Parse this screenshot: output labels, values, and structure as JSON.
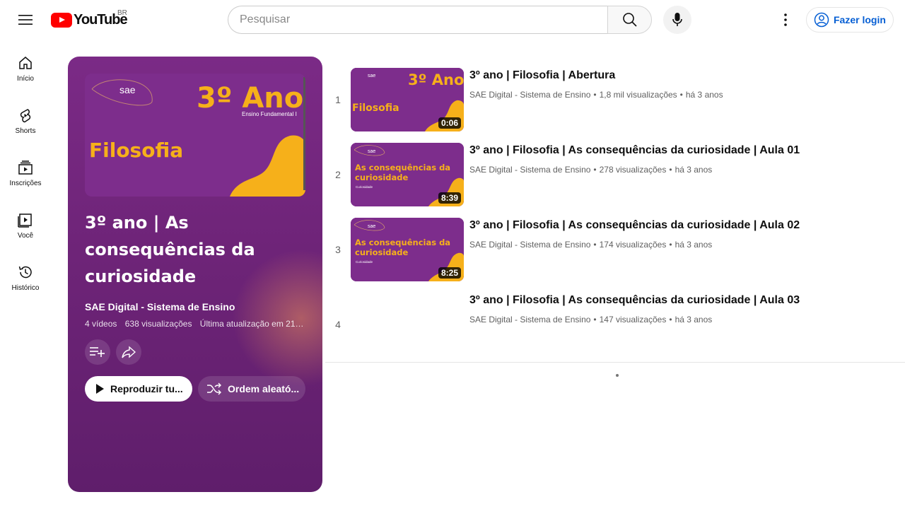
{
  "header": {
    "logo_text": "YouTube",
    "country_code": "BR",
    "search_placeholder": "Pesquisar",
    "login_label": "Fazer login"
  },
  "sidebar": {
    "items": [
      {
        "label": "Início",
        "icon": "home-icon"
      },
      {
        "label": "Shorts",
        "icon": "shorts-icon"
      },
      {
        "label": "Inscrições",
        "icon": "subscriptions-icon"
      },
      {
        "label": "Você",
        "icon": "you-icon"
      },
      {
        "label": "Histórico",
        "icon": "history-icon"
      }
    ]
  },
  "playlist": {
    "title": "3º ano | As consequências da curiosidade",
    "owner": "SAE Digital - Sistema de Ensino",
    "video_count": "4 vídeos",
    "views": "638 visualizações",
    "updated": "Última atualização em 21 d...",
    "play_all_label": "Reproduzir tu...",
    "shuffle_label": "Ordem aleató...",
    "hero_thumb": {
      "brand": "sae",
      "heading": "3º Ano",
      "subheading": "Ensino Fundamental I",
      "subject": "Filosofia"
    }
  },
  "videos": [
    {
      "index": "1",
      "title": "3º ano | Filosofia | Abertura",
      "channel": "SAE Digital - Sistema de Ensino",
      "views": "1,8 mil visualizações",
      "age": "há 3 anos",
      "duration": "0:06",
      "thumb_heading": "3º Ano",
      "thumb_subject": "Filosofia",
      "thumb_caption": ""
    },
    {
      "index": "2",
      "title": "3º ano | Filosofia | As consequências da curiosidade | Aula 01",
      "channel": "SAE Digital - Sistema de Ensino",
      "views": "278 visualizações",
      "age": "há 3 anos",
      "duration": "8:39",
      "thumb_heading": "",
      "thumb_subject": "As consequências da curiosidade",
      "thumb_caption": "Curiosidade"
    },
    {
      "index": "3",
      "title": "3º ano | Filosofia | As consequências da curiosidade | Aula 02",
      "channel": "SAE Digital - Sistema de Ensino",
      "views": "174 visualizações",
      "age": "há 3 anos",
      "duration": "8:25",
      "thumb_heading": "",
      "thumb_subject": "As consequências da curiosidade",
      "thumb_caption": "Curiosidade"
    },
    {
      "index": "4",
      "title": "3º ano | Filosofia | As consequências da curiosidade | Aula 03",
      "channel": "SAE Digital - Sistema de Ensino",
      "views": "147 visualizações",
      "age": "há 3 anos",
      "duration": "",
      "thumb_heading": "",
      "thumb_subject": "",
      "thumb_caption": ""
    }
  ],
  "colors": {
    "panel": "#6e2478",
    "thumb": "#7a2b8a",
    "accent_yellow": "#f6b01a",
    "link_blue": "#065fd4",
    "logo_red": "#ff0000"
  }
}
